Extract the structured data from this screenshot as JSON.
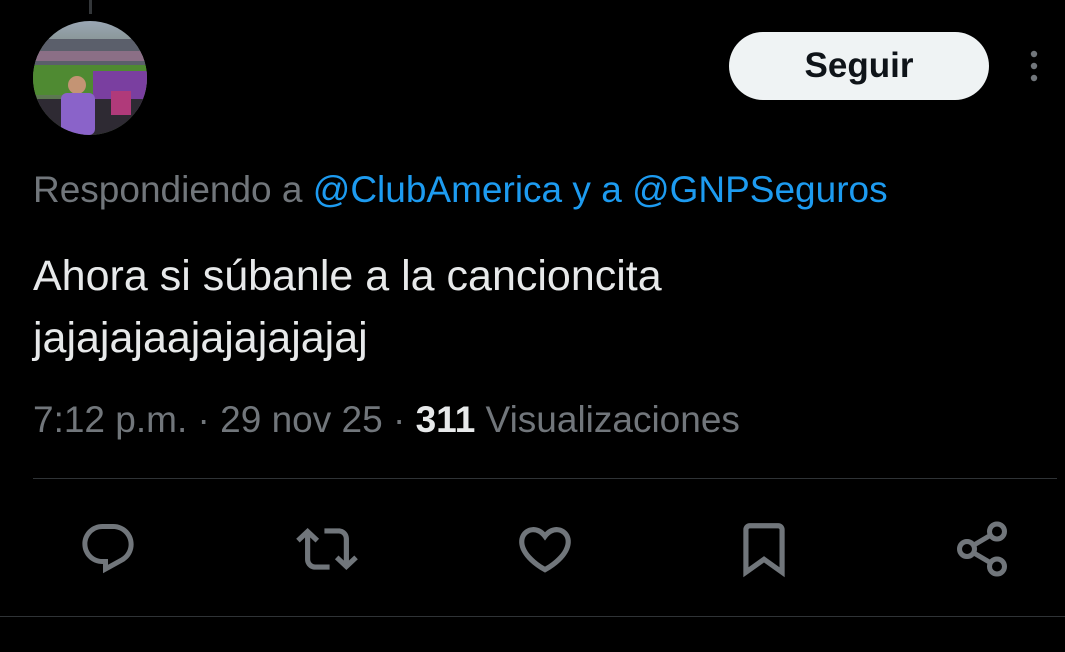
{
  "header": {
    "follow_label": "Seguir",
    "more_icon": "more-vertical-icon"
  },
  "reply": {
    "prefix": "Respondiendo a ",
    "mention_1": "@ClubAmerica",
    "connector": " y a ",
    "mention_2": "@GNPSeguros"
  },
  "tweet": {
    "text_line_1": "Ahora si súbanle a la cancioncita",
    "text_line_2": "jajajajaajajajajajaj"
  },
  "meta": {
    "time": "7:12 p.m.",
    "separator": " · ",
    "date": "29 nov 25",
    "views_count": "311",
    "views_label": " Visualizaciones"
  },
  "actions": [
    {
      "icon": "reply-icon"
    },
    {
      "icon": "retweet-icon"
    },
    {
      "icon": "like-icon"
    },
    {
      "icon": "bookmark-icon"
    },
    {
      "icon": "share-icon"
    }
  ],
  "colors": {
    "background": "#000000",
    "text_primary": "#e7e9ea",
    "text_secondary": "#71767b",
    "link": "#1d9bf0",
    "follow_button_bg": "#eff3f4",
    "icon": "#71767b"
  }
}
